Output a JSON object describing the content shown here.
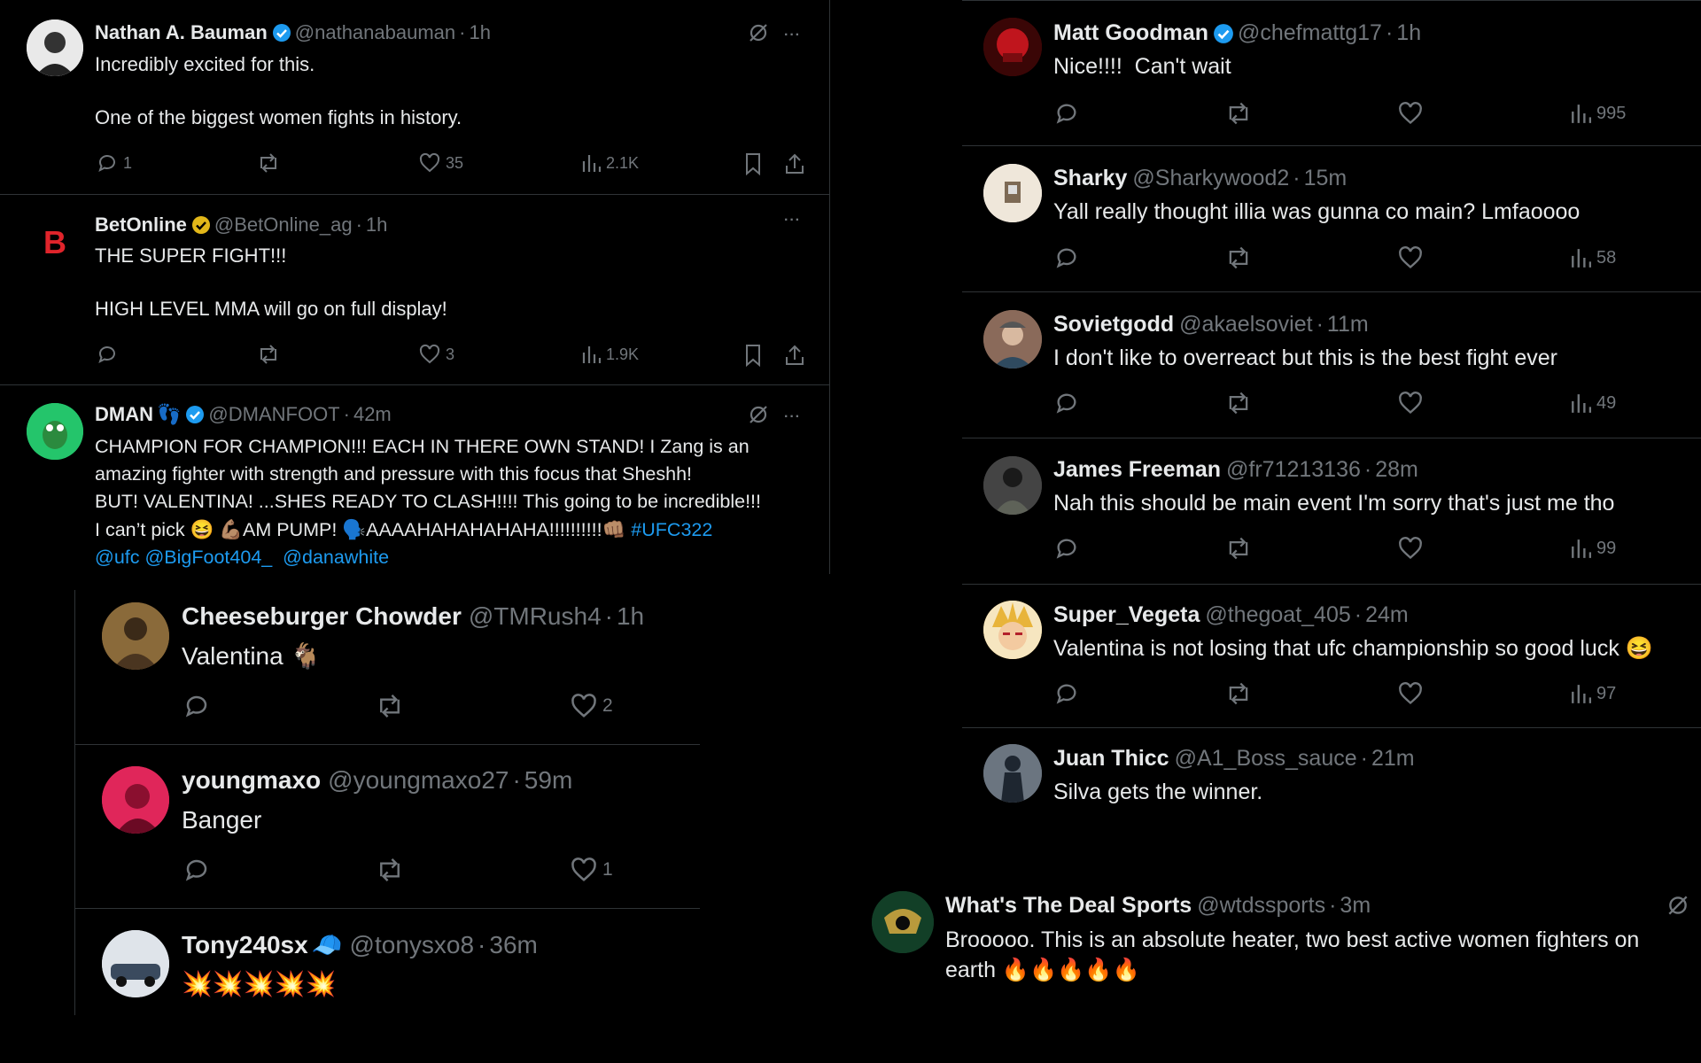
{
  "left_top": {
    "tweets": [
      {
        "name": "Nathan A. Bauman",
        "handle": "@nathanabauman",
        "time": "1h",
        "text": "Incredibly excited for this.\n\nOne of the biggest women fights in history.",
        "replies": "1",
        "likes": "35",
        "views": "2.1K"
      },
      {
        "name": "BetOnline",
        "handle": "@BetOnline_ag",
        "time": "1h",
        "text": "THE SUPER FIGHT!!!\n\nHIGH LEVEL MMA will go on full display!",
        "replies": "",
        "likes": "3",
        "views": "1.9K"
      },
      {
        "name": "DMAN",
        "emoji": "👣",
        "handle": "@DMANFOOT",
        "time": "42m",
        "text": "CHAMPION FOR CHAMPION!!! EACH IN THERE OWN STAND! I Zang is an\namazing fighter with strength and pressure with this focus that Sheshh!\nBUT! VALENTINA! ...SHES READY TO CLASH!!!! This going to be incredible!!!\nI can’t pick 😆 💪🏽AM PUMP! 🗣️AAAAHAHAHAHAHA!!!!!!!!!!👊🏽 ",
        "hashtag": "#UFC322",
        "mentions": "@ufc @BigFoot404_  @danawhite"
      }
    ]
  },
  "left_bot": {
    "tweets": [
      {
        "name": "Cheeseburger Chowder",
        "handle": "@TMRush4",
        "time": "1h",
        "text": "Valentina 🐐",
        "replies": "",
        "likes": "2"
      },
      {
        "name": "youngmaxo",
        "handle": "@youngmaxo27",
        "time": "59m",
        "text": "Banger",
        "replies": "",
        "likes": "1"
      },
      {
        "name": "Tony240sx",
        "emoji": "🧢",
        "handle": "@tonysxo8",
        "time": "36m",
        "text": "💥💥💥💥💥"
      }
    ]
  },
  "right": {
    "tweets": [
      {
        "name": "Matt Goodman",
        "handle": "@chefmattg17",
        "time": "1h",
        "text": "Nice!!!!  Can't wait",
        "views": "995"
      },
      {
        "name": "Sharky",
        "handle": "@Sharkywood2",
        "time": "15m",
        "text": "Yall really thought illia was gunna co main? Lmfaoooo",
        "views": "58"
      },
      {
        "name": "Sovietgodd",
        "handle": "@akaelsoviet",
        "time": "11m",
        "text": "I don't like to overreact but this is the best fight ever",
        "views": "49"
      },
      {
        "name": "James Freeman",
        "handle": "@fr71213136",
        "time": "28m",
        "text": "Nah this should be main event I'm sorry that's just me tho",
        "views": "99"
      },
      {
        "name": "Super_Vegeta",
        "handle": "@thegoat_405",
        "time": "24m",
        "text": "Valentina is not losing that ufc championship so good luck 😆",
        "views": "97"
      },
      {
        "name": "Juan Thicc",
        "handle": "@A1_Boss_sauce",
        "time": "21m",
        "text": "Silva gets the winner.",
        "views": ""
      }
    ]
  },
  "bottom_right": {
    "name": "What's The Deal Sports",
    "handle": "@wtdssports",
    "time": "3m",
    "text": "Brooooo. This is an absolute heater, two best active women fighters on\nearth 🔥🔥🔥🔥🔥"
  },
  "common": {
    "dot": "·",
    "more": "···"
  },
  "colors": {
    "background": "#000000",
    "text": "#e7e9ea",
    "muted": "#71767b",
    "divider": "#2f3336",
    "link": "#1d9bf0",
    "verified_blue": "#1d9bf0",
    "verified_gold": "#e2b719"
  }
}
